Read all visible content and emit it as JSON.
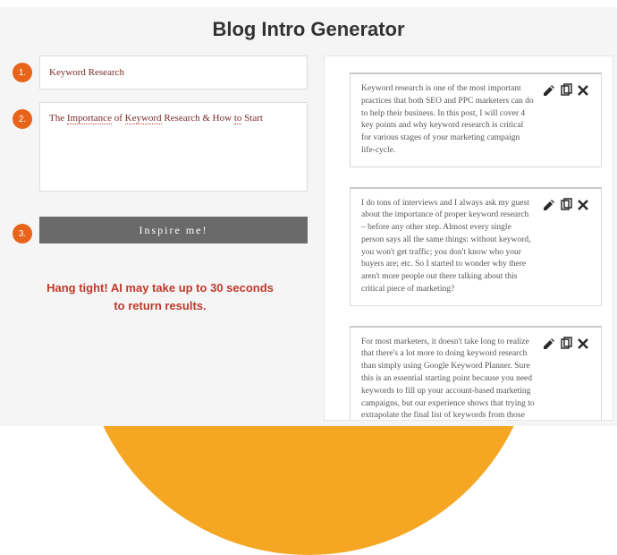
{
  "title": "Blog Intro Generator",
  "steps": {
    "s1": "1.",
    "s2": "2.",
    "s3": "3."
  },
  "form": {
    "keyword_value": "Keyword Research",
    "topic_words": [
      {
        "t": "The",
        "u": false
      },
      {
        "t": "Importance",
        "u": true
      },
      {
        "t": "of",
        "u": false
      },
      {
        "t": "Keyword",
        "u": true
      },
      {
        "t": "Research & How",
        "u": false
      },
      {
        "t": "to",
        "u": true
      },
      {
        "t": "Start",
        "u": false
      }
    ],
    "button_label": "Inspire me!"
  },
  "wait_message_l1": "Hang tight! AI may take up to 30 seconds",
  "wait_message_l2": "to return results.",
  "results": [
    {
      "text": "Keyword research is one of the most important practices that both SEO and PPC marketers can do to help their business. In this post, I will cover 4 key points and why keyword research is critical for various stages of your marketing campaign life-cycle."
    },
    {
      "text": "I do tons of interviews and I always ask my guest about the importance of proper keyword research – before any other step. Almost every single person says all the same things: without keyword, you won't get traffic; you don't know who your buyers are; etc. So I started to wonder why there aren't more people out there talking about this critical piece of marketing?"
    },
    {
      "text": "For most marketers, it doesn't take long to realize that there's a lot more to doing keyword research than simply using Google Keyword Planner. Sure this is an essential starting point because you need keywords to fill up your account-based marketing campaigns, but our experience shows that trying to extrapolate the final list of keywords from those unveiled by Keyword Planner can be troublesome."
    }
  ]
}
